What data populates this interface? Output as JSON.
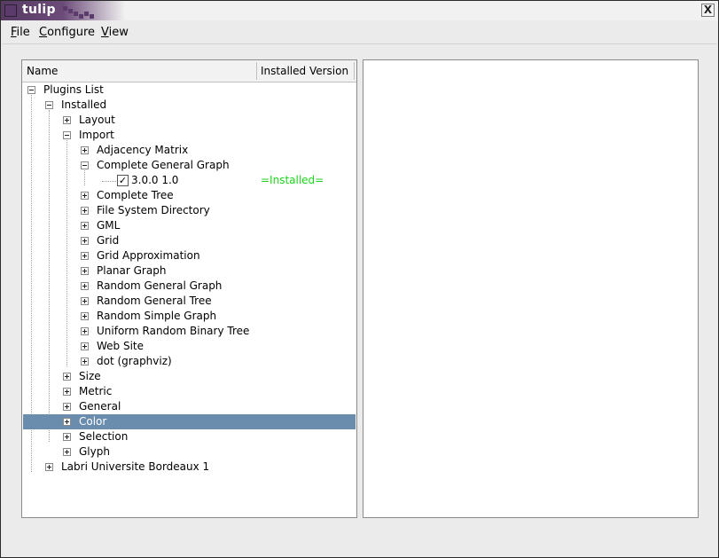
{
  "window": {
    "title": "tulip",
    "close_symbol": "X"
  },
  "menu": [
    {
      "mnemonic": "F",
      "rest": "ile"
    },
    {
      "mnemonic": "C",
      "rest": "onfigure"
    },
    {
      "mnemonic": "V",
      "rest": "iew"
    }
  ],
  "tree": {
    "columns": {
      "name": "Name",
      "version": "Installed Version"
    },
    "rows": [
      {
        "label": "Plugins List"
      },
      {
        "label": "Installed"
      },
      {
        "label": "Layout"
      },
      {
        "label": "Import"
      },
      {
        "label": "Adjacency Matrix"
      },
      {
        "label": "Complete General Graph"
      },
      {
        "label": "3.0.0 1.0",
        "version": "=Installed=",
        "checked": true
      },
      {
        "label": "Complete Tree"
      },
      {
        "label": "File System Directory"
      },
      {
        "label": "GML"
      },
      {
        "label": "Grid"
      },
      {
        "label": "Grid Approximation"
      },
      {
        "label": "Planar Graph"
      },
      {
        "label": "Random General Graph"
      },
      {
        "label": "Random General Tree"
      },
      {
        "label": "Random Simple Graph"
      },
      {
        "label": "Uniform Random Binary Tree"
      },
      {
        "label": "Web Site"
      },
      {
        "label": "dot (graphviz)"
      },
      {
        "label": "Size"
      },
      {
        "label": "Metric"
      },
      {
        "label": "General"
      },
      {
        "label": "Color",
        "selected": true
      },
      {
        "label": "Selection"
      },
      {
        "label": "Glyph"
      },
      {
        "label": "Labri Universite Bordeaux 1"
      }
    ]
  },
  "colors": {
    "selection": "#6a8cad",
    "installed_text": "#1cd41c",
    "titlebar": "#6c4b79"
  }
}
